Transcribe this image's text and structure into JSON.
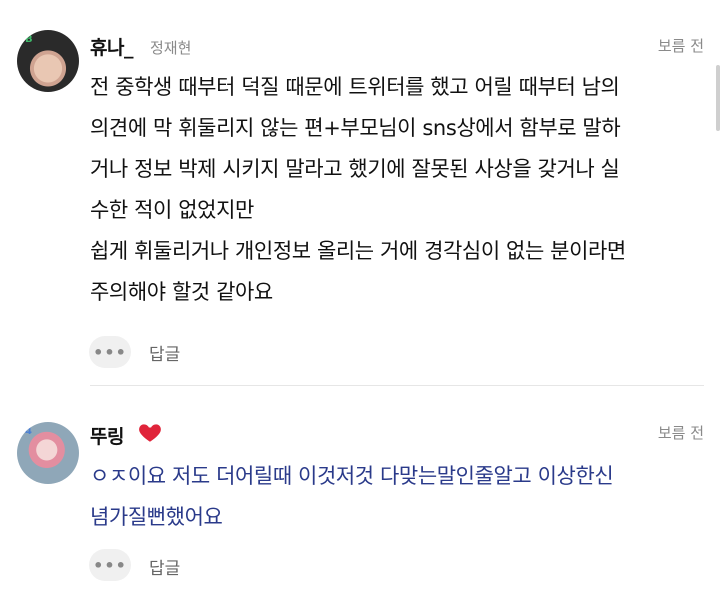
{
  "comments": [
    {
      "author": "휴나_",
      "subname": "정재현",
      "avatar_icon": "profile-photo",
      "avatar_badge": "B",
      "time": "보름 전",
      "lines": [
        "전 중학생 때부터 덕질 때문에 트위터를 했고 어릴 때부터 남의",
        "의견에 막 휘둘리지 않는 편+부모님이 sns상에서 함부로 말하",
        "거나 정보 박제 시키지 말라고 했기에 잘못된 사상을 갖거나 실",
        "수한 적이 없었지만",
        "쉽게 휘둘리거나 개인정보 올리는 거에 경각심이 없는 분이라면",
        "주의해야 할것 같아요"
      ],
      "more_label": "•••",
      "reply_label": "답글",
      "text_color": "#111111"
    },
    {
      "author": "뚜링",
      "avatar_icon": "profile-photo",
      "avatar_badge": "4",
      "heart_icon": "heart-icon",
      "heart_color": "#e0243a",
      "time": "보름 전",
      "lines": [
        "ㅇㅈ이요 저도 더어릴때 이것저것 다맞는말인줄알고 이상한신",
        "념가질뻔했어요"
      ],
      "more_label": "•••",
      "reply_label": "답글",
      "text_color": "#2a3a8a"
    }
  ]
}
